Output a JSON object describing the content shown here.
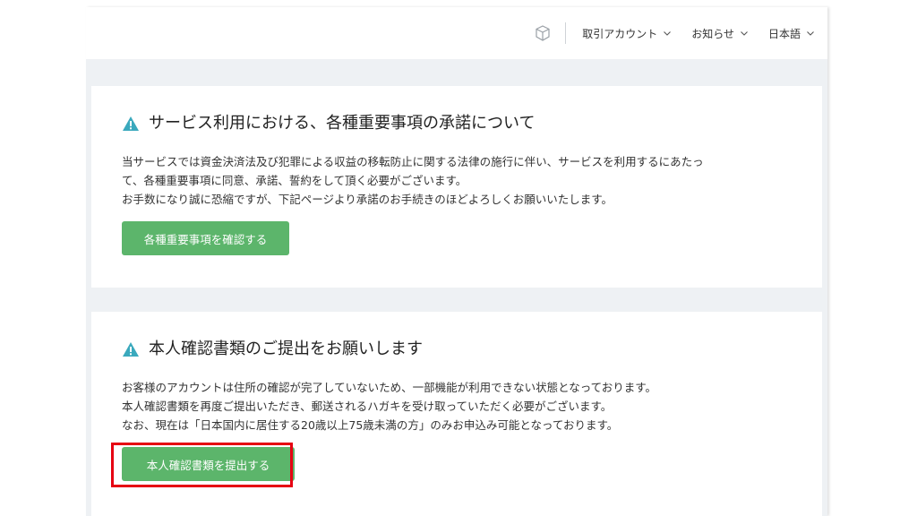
{
  "header": {
    "icon": "cube-icon",
    "nav": [
      {
        "label": "取引アカウント"
      },
      {
        "label": "お知らせ"
      },
      {
        "label": "日本語"
      }
    ]
  },
  "notices": [
    {
      "icon": "warning-icon",
      "title": "サービス利用における、各種重要事項の承諾について",
      "lines": [
        "当サービスでは資金決済法及び犯罪による収益の移転防止に関する法律の施行に伴い、サービスを利用するにあたっ",
        "て、各種重要事項に同意、承諾、誓約をして頂く必要がございます。",
        "お手数になり誠に恐縮ですが、下記ページより承諾のお手続きのほどよろしくお願いいたします。"
      ],
      "button": "各種重要事項を確認する"
    },
    {
      "icon": "warning-icon",
      "title": "本人確認書類のご提出をお願いします",
      "lines": [
        "お客様のアカウントは住所の確認が完了していないため、一部機能が利用できない状態となっております。",
        "本人確認書類を再度ご提出いただき、郵送されるハガキを受け取っていただく必要がございます。",
        "なお、現在は「日本国内に居住する20歳以上75歳未満の方」のみお申込み可能となっております。"
      ],
      "button": "本人確認書類を提出する"
    }
  ],
  "colors": {
    "button": "#5cb56b",
    "warning": "#3aa9bd",
    "highlight": "#e60012",
    "background": "#eef1f4"
  }
}
